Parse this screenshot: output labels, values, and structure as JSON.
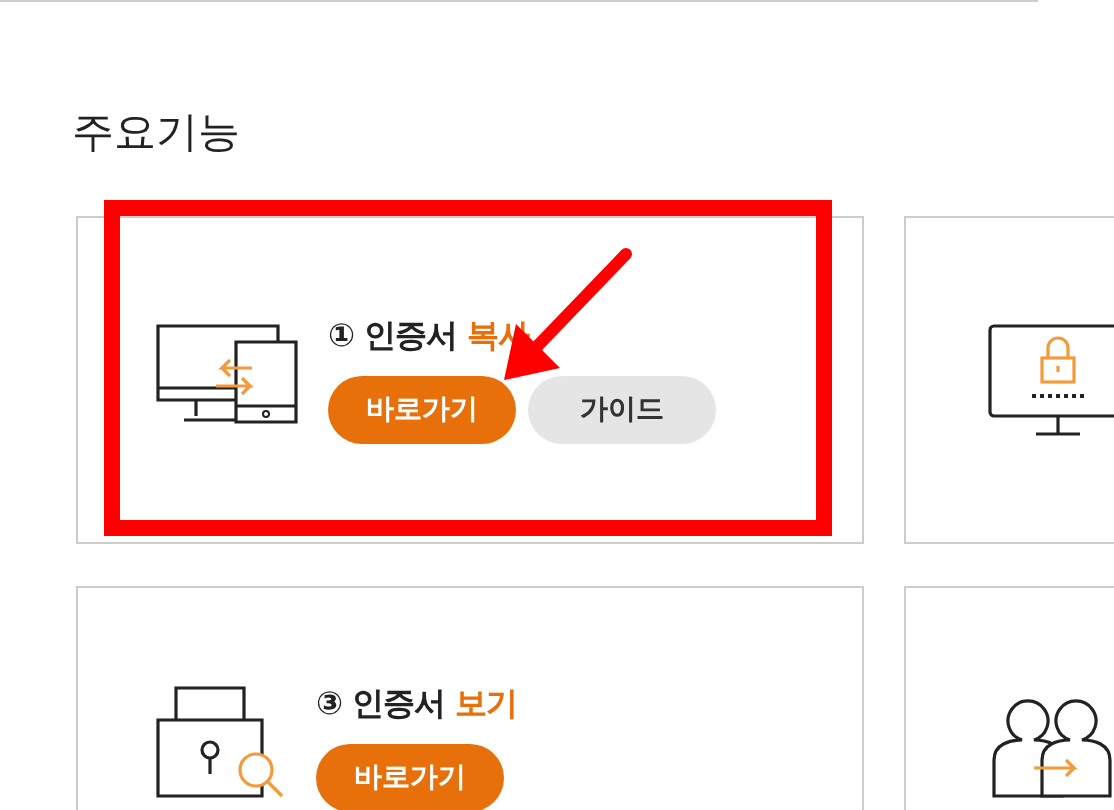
{
  "section_title": "주요기능",
  "cards": [
    {
      "kind": "copy",
      "number": "①",
      "title": "인증서",
      "highlight": "복사",
      "buttons": [
        {
          "label": "바로가기",
          "primary": true
        },
        {
          "label": "가이드",
          "primary": false
        }
      ]
    },
    {
      "kind": "lock"
    },
    {
      "kind": "view",
      "number": "③",
      "title": "인증서",
      "highlight": "보기",
      "buttons": [
        {
          "label": "바로가기",
          "primary": true
        }
      ]
    },
    {
      "kind": "people"
    }
  ],
  "annotation": {
    "highlight_box": true,
    "arrow": true
  }
}
